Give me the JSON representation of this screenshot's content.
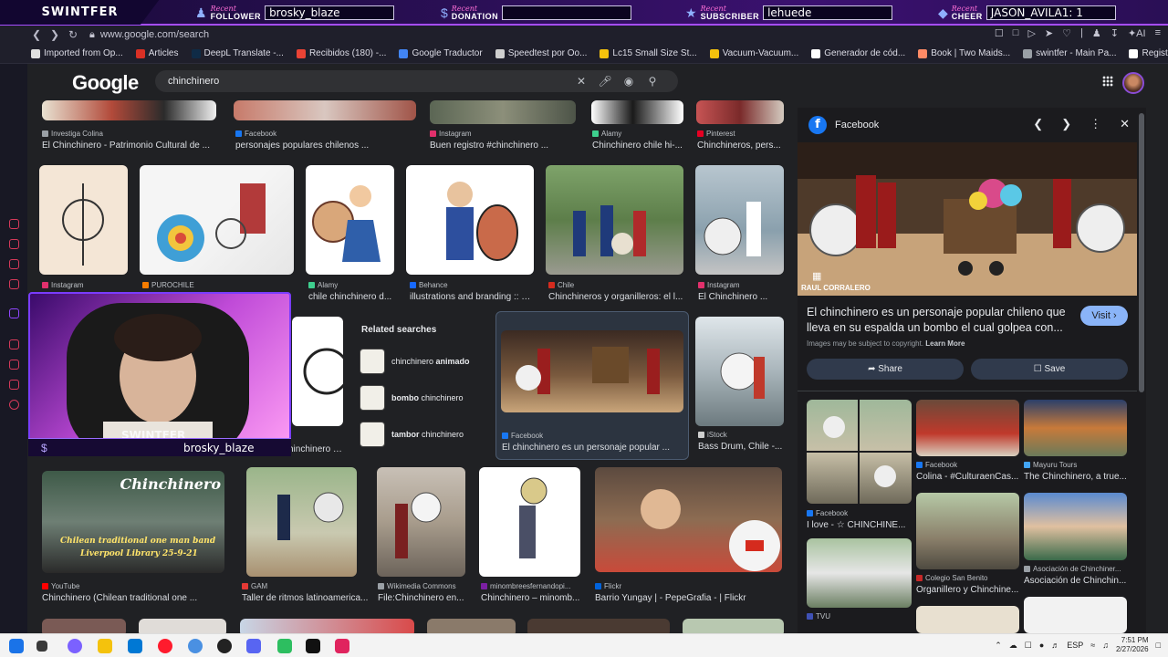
{
  "overlay": {
    "brand": "SWINTFER",
    "recent": "Recent",
    "follower": {
      "label": "FOLLOWER",
      "value": "brosky_blaze"
    },
    "donation": {
      "label": "DONATION",
      "value": ""
    },
    "subscriber": {
      "label": "SUBSCRIBER",
      "value": "lehuede"
    },
    "cheer": {
      "label": "CHEER",
      "value": "JASON_AVILA1: 1"
    },
    "cam_name": "brosky_blaze",
    "cam_logo": "SWINTFER"
  },
  "browser": {
    "url": "www.google.com/search",
    "bookmarks": [
      {
        "label": "Imported from Op...",
        "color": "#e0e0e0"
      },
      {
        "label": "Articles",
        "color": "#d93025"
      },
      {
        "label": "DeepL Translate -...",
        "color": "#0f2b46"
      },
      {
        "label": "Recibidos (180) -...",
        "color": "#ea4335"
      },
      {
        "label": "Google Traductor",
        "color": "#4285f4"
      },
      {
        "label": "Speedtest por Oo...",
        "color": "#cfcfcf"
      },
      {
        "label": "Lc15 Small Size St...",
        "color": "#f4c20d"
      },
      {
        "label": "Vacuum-Vacuum...",
        "color": "#f4c20d"
      },
      {
        "label": "Generador de cód...",
        "color": "#ffffff"
      },
      {
        "label": "Book | Two Maids...",
        "color": "#ff8a65"
      },
      {
        "label": "swintfer - Main Pa...",
        "color": "#9aa0a6"
      },
      {
        "label": "Register Your LLC,...",
        "color": "#ffffff"
      }
    ]
  },
  "google": {
    "logo": "Google",
    "query": "chinchinero"
  },
  "results": {
    "row0": [
      {
        "source": "Investiga Colina",
        "title": "El Chinchinero - Patrimonio Cultural de ...",
        "color": "#9aa0a6"
      },
      {
        "source": "Facebook",
        "title": "personajes populares chilenos ...",
        "color": "#1877f2"
      },
      {
        "source": "Instagram",
        "title": "Buen registro #chinchinero ...",
        "color": "#e1306c"
      },
      {
        "source": "Alamy",
        "title": "Chinchinero chile hi-...",
        "color": "#3ecf8e"
      },
      {
        "source": "Pinterest",
        "title": "Chinchineros, pers...",
        "color": "#e60023"
      }
    ],
    "row1": [
      {
        "source": "Instagram",
        "title": "",
        "color": "#e1306c"
      },
      {
        "source": "PUROCHILE",
        "title": "",
        "color": "#f57c00"
      },
      {
        "source": "Alamy",
        "title": "chile chinchinero d...",
        "color": "#3ecf8e"
      },
      {
        "source": "Behance",
        "title": "illustrations and branding :: B...",
        "color": "#1769ff"
      },
      {
        "source": "Chile",
        "title": "Chinchineros y organilleros: el l...",
        "color": "#d52b1e"
      },
      {
        "source": "Instagram",
        "title": "El Chinchinero ...",
        "color": "#e1306c"
      }
    ],
    "row2": [
      {
        "source": "",
        "title": "chinchinero d...",
        "color": "#9aa0a6"
      },
      {
        "source": "Facebook",
        "title": "El chinchinero es un personaje popular ...",
        "color": "#1877f2"
      },
      {
        "source": "iStock",
        "title": "Bass Drum, Chile -...",
        "color": "#cfcfcf"
      }
    ],
    "row3": [
      {
        "source": "YouTube",
        "title": "Chinchinero (Chilean traditional one ...",
        "color": "#ff0000"
      },
      {
        "source": "GAM",
        "title": "Taller de ritmos latinoamerica...",
        "color": "#e53935"
      },
      {
        "source": "Wikimedia Commons",
        "title": "File:Chinchinero en...",
        "color": "#9aa0a6"
      },
      {
        "source": "minombreesfernandopi...",
        "title": "Chinchinero – minomb...",
        "color": "#7b1fa2"
      },
      {
        "source": "Flickr",
        "title": "Barrio Yungay | - PepeGrafia - | Flickr",
        "color": "#0063dc"
      }
    ],
    "thumb_texts": {
      "youtube_header": "Chinchinero",
      "youtube_sub1": "Chilean traditional one man band",
      "youtube_sub2": "Liverpool Library 25-9-21"
    }
  },
  "related": {
    "title": "Related searches",
    "items": [
      {
        "prefix": "chinchinero ",
        "bold": "animado",
        "suffix": ""
      },
      {
        "prefix": "",
        "bold": "bombo",
        "suffix": " chinchinero"
      },
      {
        "prefix": "",
        "bold": "tambor",
        "suffix": " chinchinero"
      }
    ]
  },
  "panel": {
    "source": "Facebook",
    "image_credit": "RAUL CORRALERO",
    "description": "El chinchinero es un personaje popular chileno que lleva en su espalda un bombo el cual golpea con...",
    "visit_label": "Visit",
    "copyright": "Images may be subject to copyright.",
    "learn_more": "Learn More",
    "share_label": "Share",
    "save_label": "Save",
    "related": [
      {
        "source": "Facebook",
        "title": "I love - ☆ CHINCHINE...",
        "color": "#1877f2"
      },
      {
        "source": "Facebook",
        "title": "Colina - #CulturaenCas...",
        "color": "#1877f2"
      },
      {
        "source": "Mayuru Tours",
        "title": "The Chinchinero, a true...",
        "color": "#42a5f5"
      },
      {
        "source": "Colegio San Benito",
        "title": "Organillero y Chinchine...",
        "color": "#c62828"
      },
      {
        "source": "Asociación de Chinchiner...",
        "title": "Asociación de Chinchin...",
        "color": "#9aa0a6"
      },
      {
        "source": "TVU",
        "title": "",
        "color": "#3f51b5"
      }
    ]
  },
  "taskbar": {
    "lang": "ESP",
    "time": "7:51 PM",
    "date": "2/27/2026"
  }
}
